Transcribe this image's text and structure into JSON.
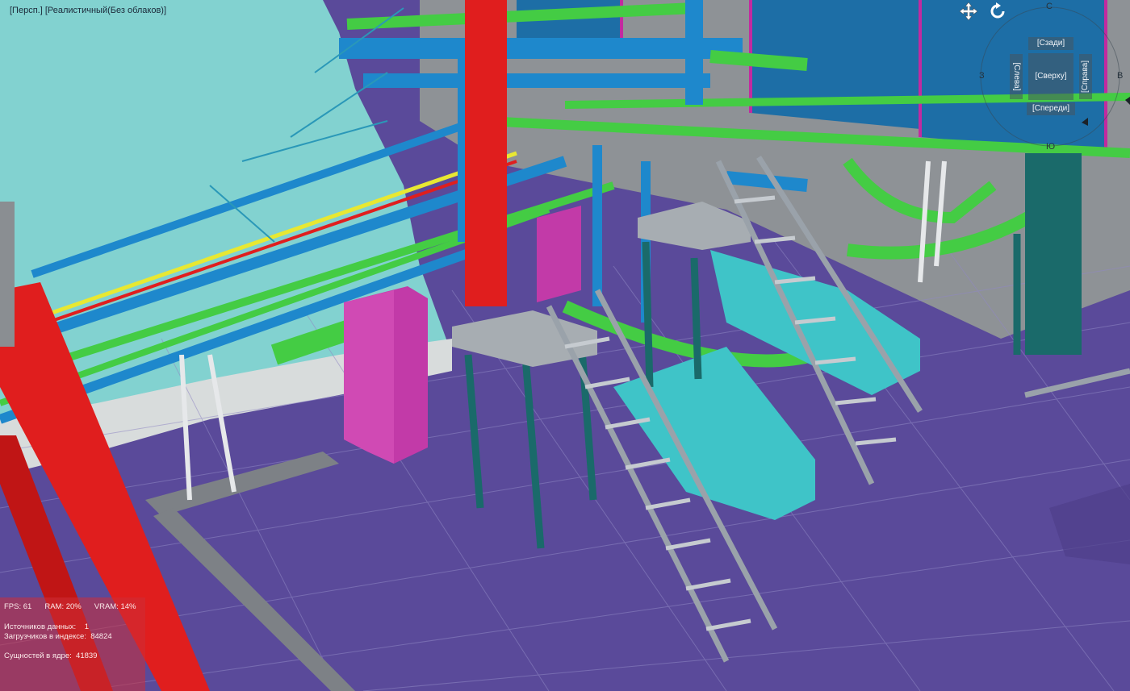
{
  "viewport": {
    "projection_label": "[Персп.]",
    "style_label": "[Реалистичный(Без облаков)]"
  },
  "navigation": {
    "pan_icon": "pan-move-icon",
    "orbit_icon": "orbit-rotate-icon"
  },
  "viewcube": {
    "faces": {
      "back": "[Сзади]",
      "left": "[Слева]",
      "top": "[Сверху]",
      "right": "[Справа]",
      "front": "[Спереди]"
    },
    "compass": {
      "north": "С",
      "south": "Ю",
      "west": "З",
      "east": "В"
    }
  },
  "stats": {
    "fps_label": "FPS:",
    "fps_value": "61",
    "ram_label": "RAM:",
    "ram_value": "20%",
    "vram_label": "VRAM:",
    "vram_value": "14%",
    "sources_label": "Источников данных:",
    "sources_value": "1",
    "loaders_label": "Загрузчиков в индексе:",
    "loaders_value": "84824",
    "entities_label": "Сущностей в ядре:",
    "entities_value": "41839"
  },
  "colors": {
    "floor": "#5a4a9a",
    "wall_cyan": "#7fd3d3",
    "pipe_blue": "#1e88cc",
    "pipe_green": "#44cc44",
    "column_red": "#e01e1e",
    "cabinet_magenta": "#c23aa8",
    "equipment_cyan": "#3fc4c8",
    "structure_teal": "#1a6a6a",
    "stair_grey": "#9aa2aa"
  }
}
